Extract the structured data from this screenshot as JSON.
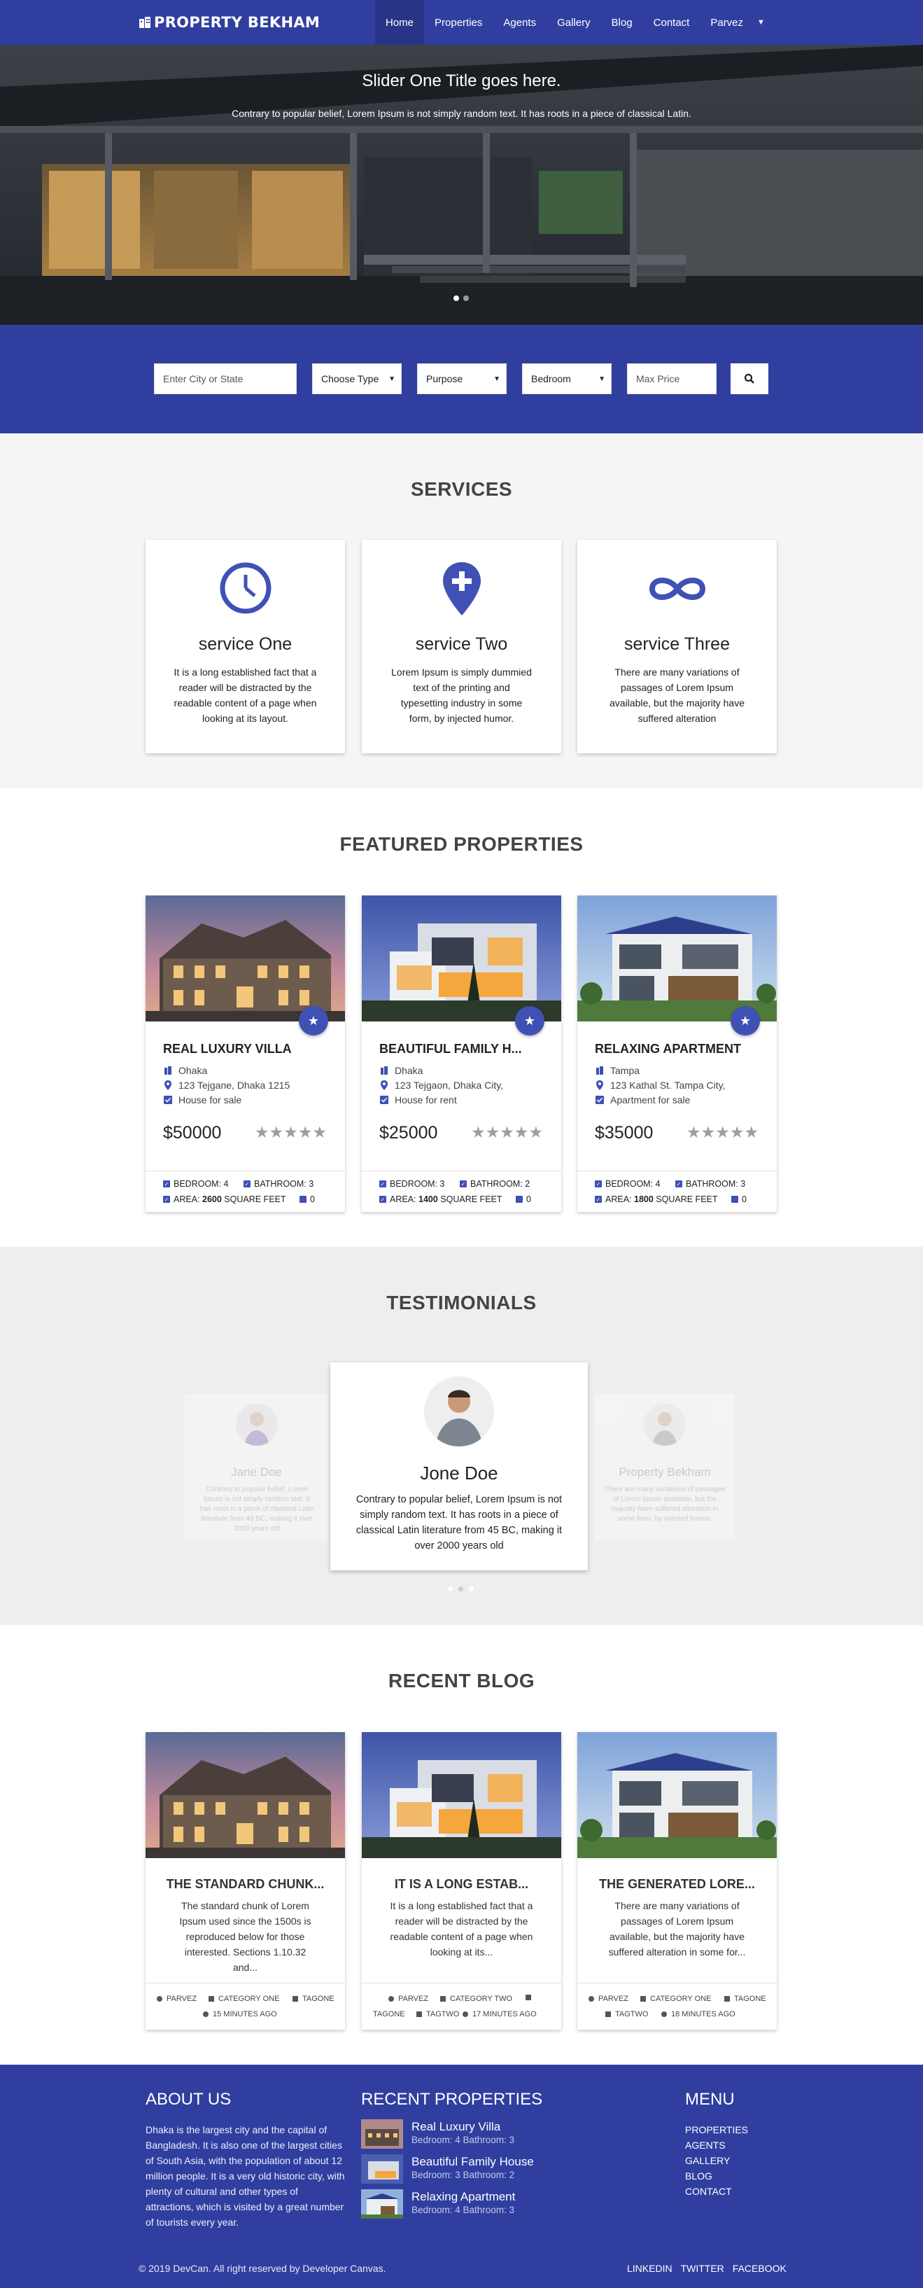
{
  "nav": {
    "brand": "PROPERTY BEKHAM",
    "items": [
      "Home",
      "Properties",
      "Agents",
      "Gallery",
      "Blog",
      "Contact",
      "Parvez"
    ]
  },
  "hero": {
    "title": "Slider One Title goes here.",
    "text": "Contrary to popular belief, Lorem Ipsum is not simply random text. It has roots in a piece of classical Latin."
  },
  "search": {
    "city_placeholder": "Enter City or State",
    "type": "Choose Type",
    "purpose": "Purpose",
    "bedroom": "Bedroom",
    "max_price": "Max Price"
  },
  "services": {
    "title": "SERVICES",
    "items": [
      {
        "title": "service One",
        "text": "It is a long established fact that a reader will be distracted by the readable content of a page when looking at its layout.",
        "icon": "clock-icon"
      },
      {
        "title": "service Two",
        "text": "Lorem Ipsum is simply dummied text of the printing and typesetting industry in some form, by injected humor.",
        "icon": "location-plus-icon"
      },
      {
        "title": "service Three",
        "text": "There are many variations of passages of Lorem Ipsum available, but the majority have suffered alteration",
        "icon": "infinity-icon"
      }
    ]
  },
  "properties": {
    "title": "FEATURED PROPERTIES",
    "items": [
      {
        "title": "REAL LUXURY VILLA",
        "city": "Ohaka",
        "address": "123 Tejgane, Dhaka 1215",
        "status": "House for sale",
        "price": "$50000",
        "bedroom": "BEDROOM: 4",
        "bathroom": "BATHROOM: 3",
        "area_label": "AREA:",
        "area_value": "2600",
        "area_unit": "SQUARE FEET",
        "comments": "0"
      },
      {
        "title": "BEAUTIFUL FAMILY H...",
        "city": "Dhaka",
        "address": "123 Tejgaon, Dhaka City,",
        "status": "House for rent",
        "price": "$25000",
        "bedroom": "BEDROOM: 3",
        "bathroom": "BATHROOM: 2",
        "area_label": "AREA:",
        "area_value": "1400",
        "area_unit": "SQUARE FEET",
        "comments": "0"
      },
      {
        "title": "RELAXING APARTMENT",
        "city": "Tampa",
        "address": "123 Kathal St. Tampa City,",
        "status": "Apartment for sale",
        "price": "$35000",
        "bedroom": "BEDROOM: 4",
        "bathroom": "BATHROOM: 3",
        "area_label": "AREA:",
        "area_value": "1800",
        "area_unit": "SQUARE FEET",
        "comments": "0"
      }
    ],
    "rating_stars": "★★★★★"
  },
  "testimonials": {
    "title": "TESTIMONIALS",
    "left": {
      "name": "Jane Doe",
      "text": "Contrary to popular belief, Lorem Ipsum is not simply random text. It has roots in a piece of classical Latin literature from 45 BC, making it over 2000 years old"
    },
    "center": {
      "name": "Jone Doe",
      "text": "Contrary to popular belief, Lorem Ipsum is not simply random text. It has roots in a piece of classical Latin literature from 45 BC, making it over 2000 years old"
    },
    "right": {
      "name": "Property Bekham",
      "text": "There are many variations of passages of Lorem Ipsum available, but the majority have suffered alteration in some form, by injected humor."
    }
  },
  "blog": {
    "title": "RECENT BLOG",
    "items": [
      {
        "title": "THE STANDARD CHUNK...",
        "text": "The standard chunk of Lorem Ipsum used since the 1500s is reproduced below for those interested. Sections 1.10.32 and...",
        "author": "PARVEZ",
        "category": "CATEGORY ONE",
        "tag1": "TAGONE",
        "tag2": "",
        "time": "15 MINUTES AGO"
      },
      {
        "title": "IT IS A LONG ESTAB...",
        "text": "It is a long established fact that a reader will be distracted by the readable content of a page when looking at its...",
        "author": "PARVEZ",
        "category": "CATEGORY TWO",
        "tag1": "TAGONE",
        "tag2": "TAGTWO",
        "time": "17 MINUTES AGO"
      },
      {
        "title": "THE GENERATED LORE...",
        "text": "There are many variations of passages of Lorem Ipsum available, but the majority have suffered alteration in some for...",
        "author": "PARVEZ",
        "category": "CATEGORY ONE",
        "tag1": "TAGONE",
        "tag2": "TAGTWO",
        "time": "18 MINUTES AGO"
      }
    ]
  },
  "footer": {
    "about_title": "ABOUT US",
    "about_text": "Dhaka is the largest city and the capital of Bangladesh. It is also one of the largest cities of South Asia, with the population of about 12 million people. It is a very old historic city, with plenty of cultural and other types of attractions, which is visited by a great number of tourists every year.",
    "recent_title": "RECENT PROPERTIES",
    "recent": [
      {
        "title": "Real Luxury Villa",
        "sub": "Bedroom: 4 Bathroom: 3"
      },
      {
        "title": "Beautiful Family House",
        "sub": "Bedroom: 3 Bathroom: 2"
      },
      {
        "title": "Relaxing Apartment",
        "sub": "Bedroom: 4 Bathroom: 3"
      }
    ],
    "menu_title": "MENU",
    "menu": [
      "PROPERTIES",
      "AGENTS",
      "GALLERY",
      "BLOG",
      "CONTACT"
    ],
    "copyright": "© 2019 DevCan. All right reserved by Developer Canvas.",
    "social": [
      "LINKEDIN",
      "TWITTER",
      "FACEBOOK"
    ]
  }
}
